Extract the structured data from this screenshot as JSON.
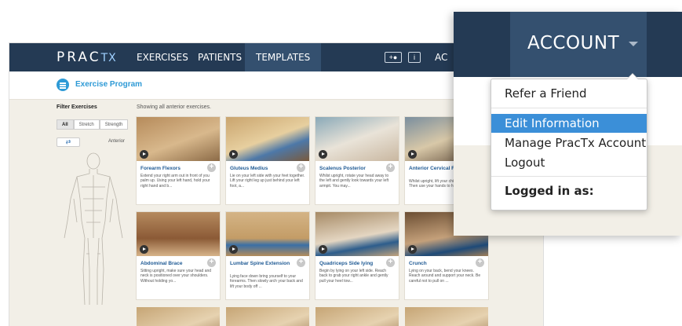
{
  "nav": {
    "logo_main": "PRAC",
    "logo_tx": "TX",
    "links": [
      "EXERCISES",
      "PATIENTS",
      "TEMPLATES"
    ],
    "active_link": "TEMPLATES",
    "add_user_icon": "add-user-icon",
    "info_icon_text": "i",
    "account_stub": "AC"
  },
  "subheader": {
    "title": "Exercise Program",
    "icon": "list-icon"
  },
  "filter": {
    "label": "Filter Exercises",
    "buttons": [
      "All",
      "Stretch",
      "Strength"
    ],
    "selected": "All",
    "view_label": "Anterior",
    "swap_icon": "swap-arrows-icon"
  },
  "showing_text": "Showing all anterior exercises.",
  "exercises": [
    {
      "title": "Forearm Flexors",
      "desc": "Extend your right arm out in front of you palm up. Using your left hand, hold your right hand and b..."
    },
    {
      "title": "Gluteus Medius",
      "desc": "Lie on your left side with your feet together. Lift your right leg up just behind your left foot, a..."
    },
    {
      "title": "Scalenus Posterior",
      "desc": "Whilst upright, rotate your head away to the left and gently look towards your left armpit. You may..."
    },
    {
      "title": "Anterior Cervical Fascia",
      "desc": "Whilst upright, lift your chin backwards. Then use your hands to hold down..."
    },
    {
      "title": "Abdominal Brace",
      "desc": "Sitting upright, make sure your head and neck is positioned over your shoulders. Without holding yo..."
    },
    {
      "title": "Lumbar Spine Extension",
      "desc": "Lying face down bring yourself to your forearms. Then slowly arch your back and lift your body off ..."
    },
    {
      "title": "Quadriceps Side lying",
      "desc": "Begin by lying on your left side. Reach back to grab your right ankle and gently pull your heel tow..."
    },
    {
      "title": "Crunch",
      "desc": "Lying on your back, bend your knees. Reach around and support your neck. Be careful not to pull on ..."
    }
  ],
  "account": {
    "label": "ACCOUNT",
    "menu": [
      "Refer a Friend",
      "Edit Information",
      "Manage PracTx Account",
      "Logout"
    ],
    "highlighted": "Edit Information",
    "logged_in_label": "Logged in as:"
  },
  "colors": {
    "nav_bg": "#243a54",
    "nav_active": "#34506f",
    "accent_blue": "#2e9ad6",
    "title_blue": "#1f5a94",
    "menu_highlight": "#3b8fd8",
    "page_bg": "#f2efe7"
  }
}
